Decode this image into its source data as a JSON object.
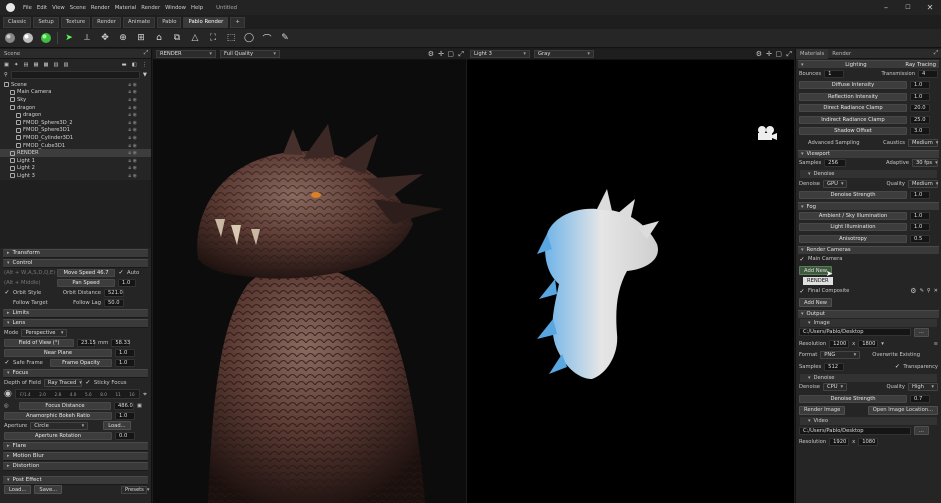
{
  "titlebar": {
    "menu": [
      "File",
      "Edit",
      "View",
      "Scene",
      "Render",
      "Material",
      "Render",
      "Window",
      "Help"
    ],
    "window_title": "Untitled"
  },
  "workspace_tabs": [
    "Classic",
    "Setup",
    "Texture",
    "Render",
    "Animate",
    "Pablo",
    "Pablo Render",
    "+"
  ],
  "scene": {
    "panel_title": "Scene",
    "items": [
      {
        "label": "Scene",
        "depth": 0
      },
      {
        "label": "Main Camera",
        "depth": 1
      },
      {
        "label": "Sky",
        "depth": 1
      },
      {
        "label": "dragon",
        "depth": 1
      },
      {
        "label": "dragon",
        "depth": 2
      },
      {
        "label": "FMOD_Sphere3D_2",
        "depth": 2
      },
      {
        "label": "FMOD_Sphere3D1",
        "depth": 2
      },
      {
        "label": "FMOD_Cylinder3D1",
        "depth": 2
      },
      {
        "label": "FMOD_Cube3D1",
        "depth": 2
      },
      {
        "label": "RENDER",
        "depth": 1
      },
      {
        "label": "Light 1",
        "depth": 1
      },
      {
        "label": "Light 2",
        "depth": 1
      },
      {
        "label": "Light 3",
        "depth": 1
      }
    ]
  },
  "left": {
    "transform": "Transform",
    "control": "Control",
    "key_hint1": "(Alt + W,A,S,D,Q,E)",
    "move_speed_label": "Move Speed",
    "move_speed": "46.7",
    "auto_label": "Auto",
    "key_hint2": "(Alt + Middle)",
    "pan_speed_label": "Pan Speed",
    "pan_speed": "1.0",
    "orbit_style_label": "Orbit Style",
    "orbit_distance_label": "Orbit Distance",
    "orbit_distance": "521.0",
    "follow_target_label": "Follow Target",
    "follow_lag_label": "Follow Lag",
    "follow_lag": "50.0",
    "limits": "Limits",
    "lens": "Lens",
    "mode_label": "Mode",
    "mode_value": "Perspective",
    "fov_label": "Field of View (°)",
    "fov_value": "23.15",
    "mm_label": "mm",
    "mm_value": "58.33",
    "near_plane_label": "Near Plane",
    "near_plane": "1.0",
    "safe_frame_label": "Safe Frame",
    "frame_opacity_label": "Frame Opacity",
    "frame_opacity": "1.0",
    "focus": "Focus",
    "dof_label": "Depth of Field",
    "dof_value": "Ray Traced",
    "sticky_focus_label": "Sticky Focus",
    "fstops": [
      "F/1.4",
      "2.0",
      "2.8",
      "4.0",
      "5.6",
      "8.0",
      "11",
      "16"
    ],
    "focus_distance_label": "Focus Distance",
    "focus_distance": "486.0",
    "anamorphic_label": "Anamorphic Bokeh Ratio",
    "anamorphic": "1.0",
    "aperture_label": "Aperture",
    "aperture_value": "Circle",
    "load_label": "Load...",
    "aperture_rotation_label": "Aperture Rotation",
    "aperture_rotation": "0.0",
    "flare": "Flare",
    "motion_blur": "Motion Blur",
    "distortion": "Distortion",
    "post_effect": "Post Effect",
    "load_btn": "Load...",
    "save_btn": "Save...",
    "presets_label": "Presets"
  },
  "viewport1": {
    "camera": "RENDER",
    "quality": "Full Quality"
  },
  "viewport2": {
    "camera": "Light 3",
    "quality": "Gray"
  },
  "right": {
    "tabs": [
      "Materials",
      "Render"
    ],
    "lighting": "Lighting",
    "lighting_mode": "Ray Tracing",
    "bounces_label": "Bounces",
    "bounces": "1",
    "transmission_label": "Transmission",
    "transmission": "4",
    "diffuse_intensity_label": "Diffuse Intensity",
    "diffuse_intensity": "1.0",
    "reflection_intensity_label": "Reflection Intensity",
    "reflection_intensity": "1.0",
    "direct_clamp_label": "Direct Radiance Clamp",
    "direct_clamp": "20.0",
    "indirect_clamp_label": "Indirect Radiance Clamp",
    "indirect_clamp": "25.0",
    "shadow_offset_label": "Shadow Offset",
    "shadow_offset": "3.0",
    "advanced_sampling_label": "Advanced Sampling",
    "caustics_label": "Caustics",
    "caustics_value": "Medium",
    "viewport": "Viewport",
    "samples_label": "Samples",
    "samples": "256",
    "adaptive_label": "Adaptive",
    "adaptive_value": "30 fps",
    "denoise_sub": "Denoise",
    "denoise_label": "Denoise",
    "denoise_value": "GPU",
    "quality_label": "Quality",
    "quality_value": "Medium",
    "denoise_strength_label": "Denoise Strength",
    "denoise_strength": "1.0",
    "fog": "Fog",
    "ambient_label": "Ambient / Sky Illumination",
    "ambient": "1.0",
    "light_illum_label": "Light Illumination",
    "light_illum": "1.0",
    "anisotropy_label": "Anisotropy",
    "anisotropy": "0.5",
    "render_cameras": "Render Cameras",
    "main_camera_label": "Main Camera",
    "add_new_label": "Add New",
    "dropdown_item": "RENDER",
    "final_composite_label": "Final Composite",
    "add_new2_label": "Add New",
    "output": "Output",
    "image_sub": "Image",
    "image_path": "C:/Users/Pablo/Desktop",
    "browse": "...",
    "resolution_label": "Resolution",
    "res_w": "1200",
    "res_x": "x",
    "res_h": "1800",
    "format_label": "Format",
    "format_value": "PNG",
    "overwrite_label": "Overwrite Existing",
    "out_samples_label": "Samples",
    "out_samples": "512",
    "transparency_label": "Transparency",
    "out_denoise_sub": "Denoise",
    "out_denoise_label": "Denoise",
    "out_denoise_value": "CPU",
    "out_quality_label": "Quality",
    "out_quality_value": "High",
    "out_denoise_strength_label": "Denoise Strength",
    "out_denoise_strength": "0.7",
    "render_image_label": "Render Image",
    "open_location_label": "Open Image Location...",
    "video_sub": "Video",
    "video_path": "C:/Users/Pablo/Desktop",
    "video_res_label": "Resolution",
    "video_res_w": "1920",
    "video_res_x": "x",
    "video_res_h": "1080"
  }
}
